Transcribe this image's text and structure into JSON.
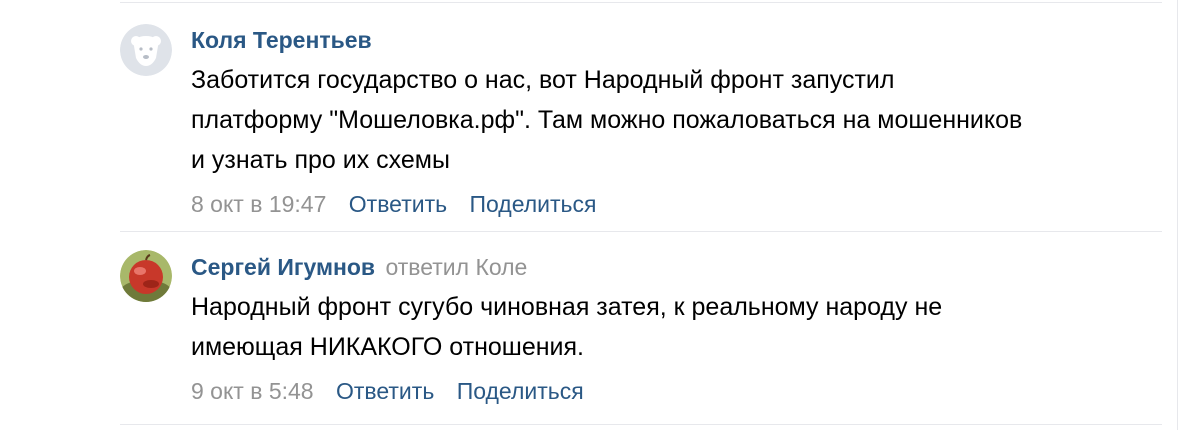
{
  "comments": [
    {
      "author": "Коля Терентьев",
      "reply_to": "",
      "avatar_icon": "default-bear-avatar-icon",
      "text": "Заботится государство о нас, вот Народный фронт запустил\nплатформу \"Мошеловка.рф\". Там можно пожаловаться на мошенников\nи узнать про их схемы",
      "date": "8 окт в 19:47",
      "reply_label": "Ответить",
      "share_label": "Поделиться"
    },
    {
      "author": "Сергей Игумнов",
      "reply_to": "ответил Коле",
      "avatar_icon": "apple-photo-avatar",
      "text": "Народный фронт сугубо чиновная затея, к реальному народу не\nимеющая НИКАКОГО отношения.",
      "date": "9 окт в 5:48",
      "reply_label": "Ответить",
      "share_label": "Поделиться"
    }
  ],
  "colors": {
    "link": "#2a5885",
    "muted": "#939393",
    "divider": "#e7e8ec"
  }
}
